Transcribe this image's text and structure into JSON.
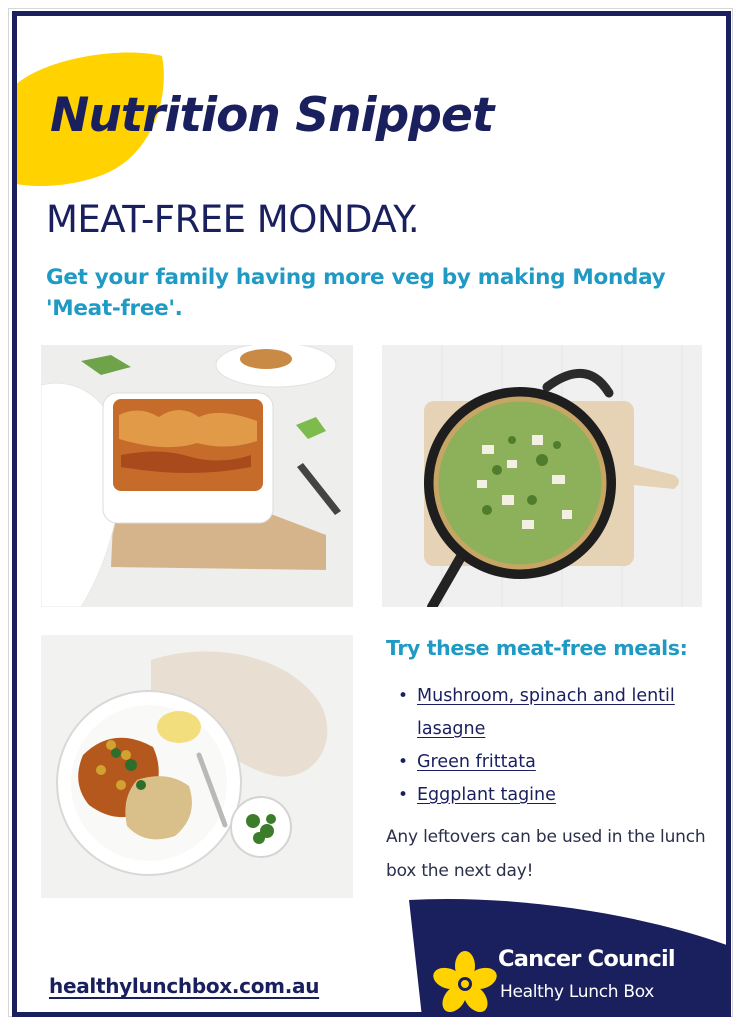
{
  "poster": {
    "title": "Nutrition Snippet",
    "headline": "MEAT-FREE MONDAY.",
    "subhead": "Get your family having more veg by making Monday 'Meat-free'.",
    "meals_heading": "Try these meat-free meals:",
    "meals": [
      {
        "label": "Mushroom, spinach and lentil lasagne"
      },
      {
        "label": "Green frittata"
      },
      {
        "label": "Eggplant tagine"
      }
    ],
    "note": "Any leftovers can be used in the lunch box the next day!",
    "website": "healthylunchbox.com.au",
    "brand": {
      "name": "Cancer Council",
      "sub": "Healthy Lunch Box"
    },
    "photos": [
      {
        "subject": "lasagne"
      },
      {
        "subject": "green frittata"
      },
      {
        "subject": "eggplant tagine"
      }
    ]
  },
  "colors": {
    "navy": "#1a1f5e",
    "teal": "#1f9ac4",
    "yellow": "#ffd200"
  },
  "icons": [
    "daffodil-icon",
    "yellow-blob-decoration"
  ]
}
